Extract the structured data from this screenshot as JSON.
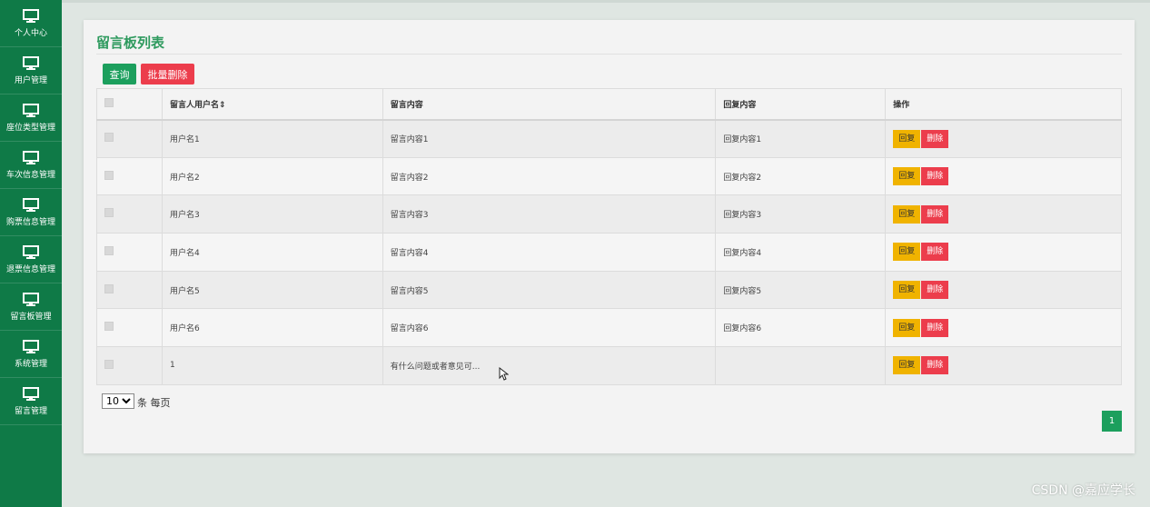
{
  "sidebar": {
    "items": [
      {
        "label": "个人中心",
        "icon": "monitor-icon"
      },
      {
        "label": "用户管理",
        "icon": "monitor-icon"
      },
      {
        "label": "座位类型管理",
        "icon": "monitor-icon"
      },
      {
        "label": "车次信息管理",
        "icon": "monitor-icon"
      },
      {
        "label": "购票信息管理",
        "icon": "monitor-icon"
      },
      {
        "label": "退票信息管理",
        "icon": "monitor-icon"
      },
      {
        "label": "留言板管理",
        "icon": "monitor-icon"
      },
      {
        "label": "系统管理",
        "icon": "monitor-icon"
      },
      {
        "label": "留言管理",
        "icon": "monitor-icon"
      }
    ]
  },
  "panel": {
    "title": "留言板列表",
    "query_label": "查询",
    "batch_delete_label": "批量删除"
  },
  "table": {
    "headers": [
      "留言人用户名",
      "留言内容",
      "回复内容",
      "操作"
    ],
    "sort_glyph": "⇕",
    "reply_label": "回复",
    "delete_label": "删除",
    "rows": [
      {
        "user": "用户名1",
        "content": "留言内容1",
        "reply": "回复内容1"
      },
      {
        "user": "用户名2",
        "content": "留言内容2",
        "reply": "回复内容2"
      },
      {
        "user": "用户名3",
        "content": "留言内容3",
        "reply": "回复内容3"
      },
      {
        "user": "用户名4",
        "content": "留言内容4",
        "reply": "回复内容4"
      },
      {
        "user": "用户名5",
        "content": "留言内容5",
        "reply": "回复内容5"
      },
      {
        "user": "用户名6",
        "content": "留言内容6",
        "reply": "回复内容6"
      },
      {
        "user": "1",
        "content": "有什么问题或者意见可...",
        "reply": ""
      }
    ]
  },
  "pager": {
    "page_size": "10",
    "page_size_suffix": "条 每页",
    "current_page": "1"
  },
  "watermark": "CSDN @嘉应学长",
  "colors": {
    "sidebar": "#0f7a47",
    "primary": "#1c9f5d",
    "danger": "#ec3d4c",
    "warning": "#f0b300",
    "title": "#2e9a5e"
  }
}
